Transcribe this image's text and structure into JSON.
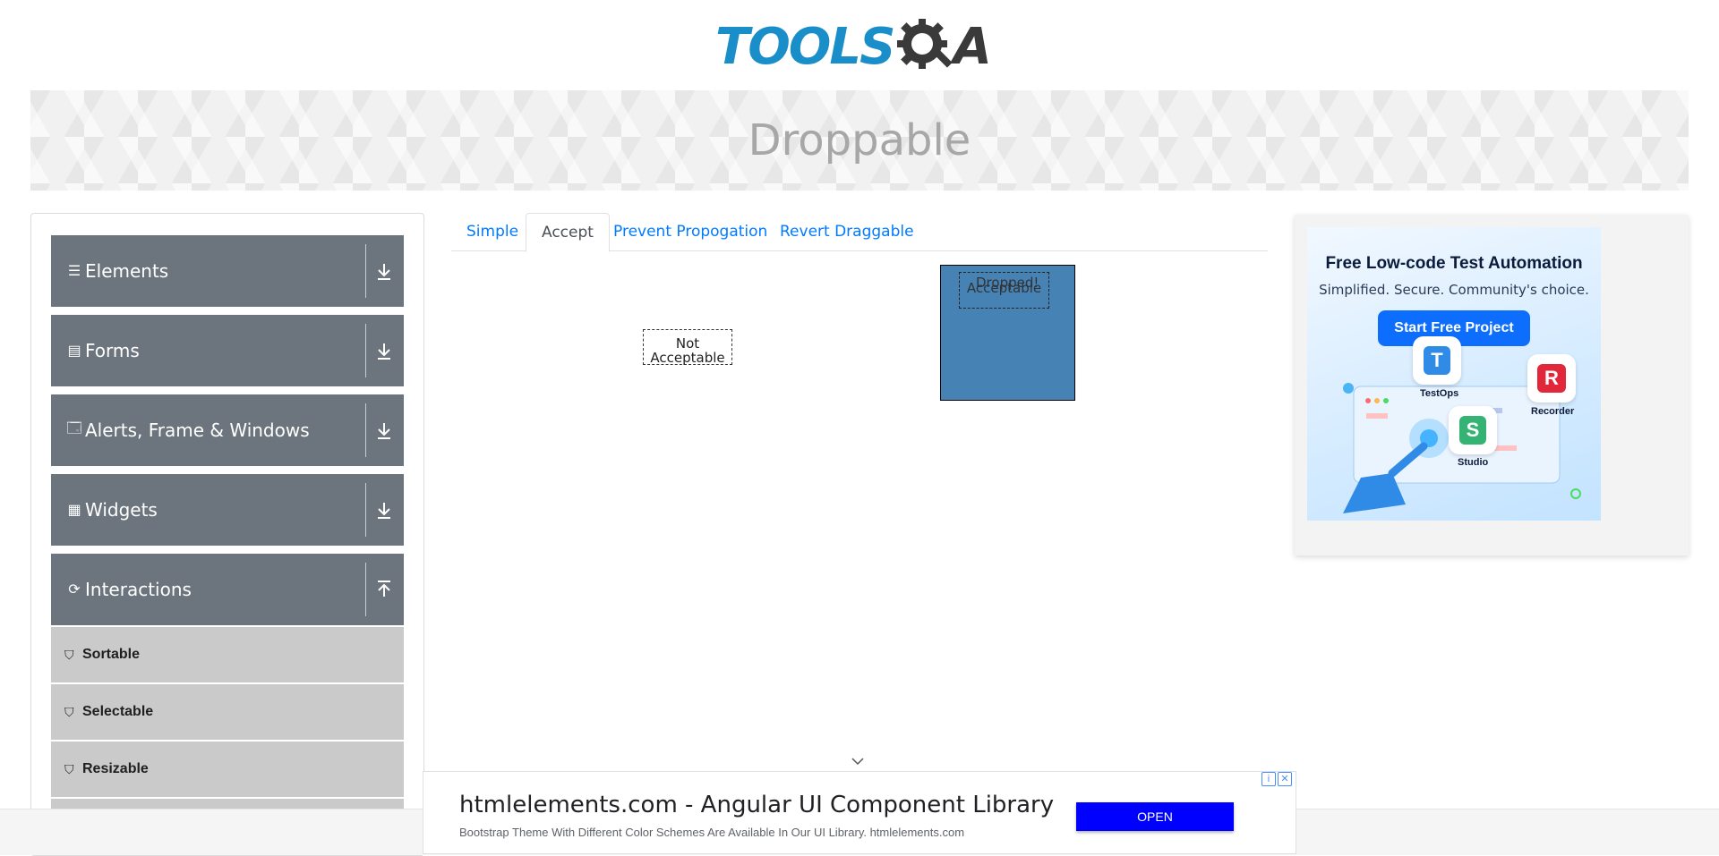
{
  "header": {
    "logo_tools": "TOOLS",
    "logo_a": "A"
  },
  "page_title": "Droppable",
  "sidebar": {
    "groups": [
      {
        "label": "Elements",
        "icon": "hamburger-icon"
      },
      {
        "label": "Forms",
        "icon": "document-icon"
      },
      {
        "label": "Alerts, Frame & Windows",
        "icon": "window-icon"
      },
      {
        "label": "Widgets",
        "icon": "grid-icon"
      },
      {
        "label": "Interactions",
        "icon": "refresh-icon",
        "expanded": true
      }
    ],
    "items": [
      {
        "label": "Sortable"
      },
      {
        "label": "Selectable"
      },
      {
        "label": "Resizable"
      }
    ]
  },
  "tabs": [
    {
      "label": "Simple",
      "active": false
    },
    {
      "label": "Accept",
      "active": true
    },
    {
      "label": "Prevent Propogation",
      "active": false
    },
    {
      "label": "Revert Draggable",
      "active": false
    }
  ],
  "drag": {
    "not_acceptable": "Not Acceptable",
    "acceptable": "Acceptable",
    "dropped": "Dropped!"
  },
  "ad_right": {
    "title": "Free Low-code Test Automation",
    "subtitle": "Simplified. Secure. Community's choice.",
    "button": "Start Free Project",
    "apps": [
      "TestOps",
      "Recorder",
      "Studio"
    ]
  },
  "ad_bottom": {
    "title": "htmlelements.com - Angular UI Component Library",
    "description": "Bootstrap Theme With Different Color Schemes Are Available In Our UI Library. htmlelements.com",
    "button": "OPEN"
  },
  "colors": {
    "brand": "#1a8ec8",
    "sidebar_group": "#6c757d",
    "sidebar_item": "#cacaca",
    "tab_link": "#007bff",
    "drop_box": "#4682b4",
    "open_button": "#0000ff"
  }
}
